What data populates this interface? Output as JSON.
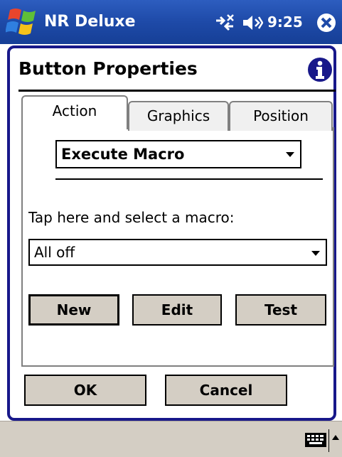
{
  "titlebar": {
    "app_title": "NR Deluxe",
    "clock": "9:25"
  },
  "dialog": {
    "title": "Button Properties"
  },
  "tabs": [
    {
      "label": "Action",
      "active": true
    },
    {
      "label": "Graphics",
      "active": false
    },
    {
      "label": "Position",
      "active": false
    }
  ],
  "action": {
    "selected": "Execute Macro"
  },
  "macro": {
    "prompt": "Tap here and select a macro:",
    "selected": "All off"
  },
  "buttons": {
    "new": "New",
    "edit": "Edit",
    "test": "Test",
    "ok": "OK",
    "cancel": "Cancel"
  },
  "icons": {
    "start": "windows-start-icon",
    "connectivity": "connectivity-icon",
    "volume": "speaker-icon",
    "close": "close-icon",
    "info": "info-icon",
    "keyboard": "keyboard-icon"
  },
  "colors": {
    "titlebar": "#1e4aa8",
    "frame": "#18188a",
    "button_face": "#d4cec4",
    "bottombar": "#d4cec4"
  }
}
